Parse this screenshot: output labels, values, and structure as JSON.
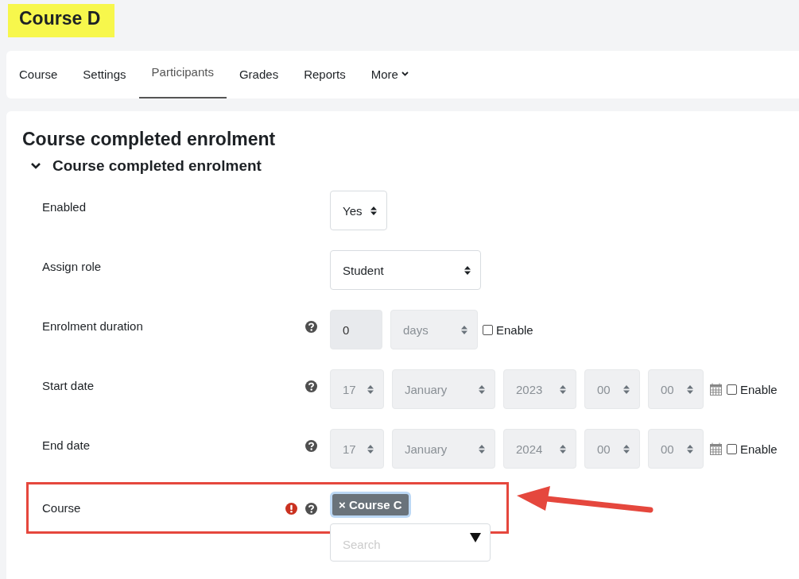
{
  "page_title": "Course D",
  "nav_tabs": [
    {
      "label": "Course",
      "selected": false,
      "kind": "link"
    },
    {
      "label": "Settings",
      "selected": false,
      "kind": "link"
    },
    {
      "label": "Participants",
      "selected": true,
      "kind": "link"
    },
    {
      "label": "Grades",
      "selected": false,
      "kind": "link"
    },
    {
      "label": "Reports",
      "selected": false,
      "kind": "link"
    },
    {
      "label": "More",
      "selected": false,
      "kind": "menu"
    }
  ],
  "heading": "Course completed enrolment",
  "section": {
    "title": "Course completed enrolment",
    "expanded": true
  },
  "fields": [
    {
      "kind": "select",
      "label": "Enabled",
      "help": false,
      "required": false,
      "value": "Yes",
      "highlighted": false
    },
    {
      "kind": "select",
      "label": "Assign role",
      "help": false,
      "required": false,
      "value": "Student",
      "highlighted": false
    },
    {
      "kind": "duration",
      "label": "Enrolment duration",
      "help": true,
      "required": false,
      "disabled": true,
      "number": "0",
      "unit": "days",
      "enable_label": "Enable",
      "checked": false,
      "highlighted": false
    },
    {
      "kind": "date",
      "label": "Start date",
      "help": true,
      "required": false,
      "disabled": true,
      "parts": [
        "17",
        "January",
        "2023",
        "00",
        "00"
      ],
      "enable_label": "Enable",
      "checked": false,
      "highlighted": false
    },
    {
      "kind": "date",
      "label": "End date",
      "help": true,
      "required": false,
      "disabled": true,
      "parts": [
        "17",
        "January",
        "2024",
        "00",
        "00"
      ],
      "enable_label": "Enable",
      "checked": false,
      "highlighted": false
    },
    {
      "kind": "autocomplete",
      "label": "Course",
      "help": true,
      "required": true,
      "tags": [
        "× Course C"
      ],
      "placeholder": "Search",
      "highlighted": true
    }
  ]
}
